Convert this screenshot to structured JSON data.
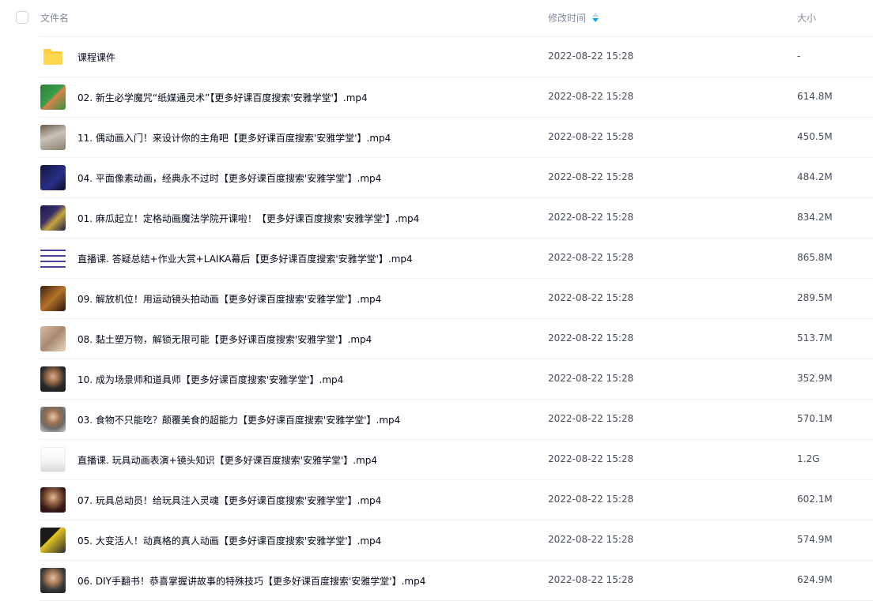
{
  "header": {
    "name_label": "文件名",
    "time_label": "修改时间",
    "size_label": "大小"
  },
  "files": [
    {
      "name": "课程课件",
      "time": "2022-08-22 15:28",
      "size": "-",
      "type": "folder-icon"
    },
    {
      "name": "02. 新生必学魔咒“纸媒通灵术”【更多好课百度搜索'安雅学堂'】.mp4",
      "time": "2022-08-22 15:28",
      "size": "614.8M",
      "thumb": "t-green"
    },
    {
      "name": "11. 偶动画入门！来设计你的主角吧【更多好课百度搜索'安雅学堂'】.mp4",
      "time": "2022-08-22 15:28",
      "size": "450.5M",
      "thumb": "t-desk"
    },
    {
      "name": "04. 平面像素动画，经典永不过时【更多好课百度搜索'安雅学堂'】.mp4",
      "time": "2022-08-22 15:28",
      "size": "484.2M",
      "thumb": "t-dark1"
    },
    {
      "name": "01. 麻瓜起立！定格动画魔法学院开课啦！【更多好课百度搜索'安雅学堂'】.mp4",
      "time": "2022-08-22 15:28",
      "size": "834.2M",
      "thumb": "t-dark2"
    },
    {
      "name": "直播课. 答疑总结+作业大赏+LAIKA幕后【更多好课百度搜索'安雅学堂'】.mp4",
      "time": "2022-08-22 15:28",
      "size": "865.8M",
      "thumb": "t-doc"
    },
    {
      "name": "09. 解放机位！用运动镜头拍动画【更多好课百度搜索'安雅学堂'】.mp4",
      "time": "2022-08-22 15:28",
      "size": "289.5M",
      "thumb": "t-warm"
    },
    {
      "name": "08. 黏土塑万物，解锁无限可能【更多好课百度搜索'安雅学堂'】.mp4",
      "time": "2022-08-22 15:28",
      "size": "513.7M",
      "thumb": "t-hand"
    },
    {
      "name": "10. 成为场景师和道具师【更多好课百度搜索'安雅学堂'】.mp4",
      "time": "2022-08-22 15:28",
      "size": "352.9M",
      "thumb": "t-face"
    },
    {
      "name": "03. 食物不只能吃？颠覆美食的超能力【更多好课百度搜索'安雅学堂'】.mp4",
      "time": "2022-08-22 15:28",
      "size": "570.1M",
      "thumb": "t-face2"
    },
    {
      "name": "直播课. 玩具动画表演+镜头知识【更多好课百度搜索'安雅学堂'】.mp4",
      "time": "2022-08-22 15:28",
      "size": "1.2G",
      "thumb": "t-white"
    },
    {
      "name": "07. 玩具总动员！给玩具注入灵魂【更多好课百度搜索'安雅学堂'】.mp4",
      "time": "2022-08-22 15:28",
      "size": "602.1M",
      "thumb": "t-face3"
    },
    {
      "name": "05. 大变活人！动真格的真人动画【更多好课百度搜索'安雅学堂'】.mp4",
      "time": "2022-08-22 15:28",
      "size": "574.9M",
      "thumb": "t-yellow"
    },
    {
      "name": "06. DIY手翻书！恭喜掌握讲故事的特殊技巧【更多好课百度搜索'安雅学堂'】.mp4",
      "time": "2022-08-22 15:28",
      "size": "624.9M",
      "thumb": "t-face4"
    }
  ],
  "colors": {
    "sort_active": "#06a7ff",
    "folder": "#ffcf3d"
  }
}
